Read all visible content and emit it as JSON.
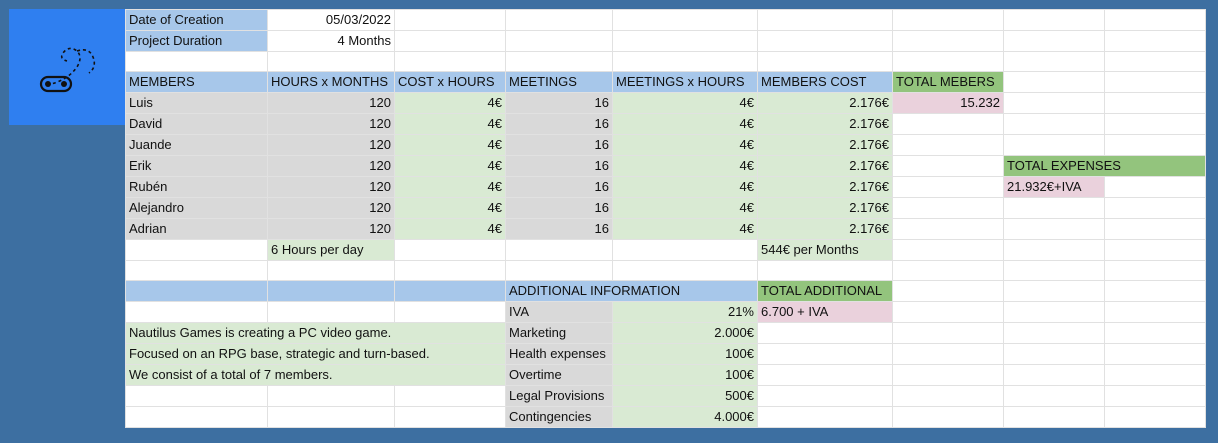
{
  "info": {
    "date_label": "Date of Creation",
    "date_value": "05/03/2022",
    "duration_label": "Project Duration",
    "duration_value": "4 Months"
  },
  "members_table": {
    "headers": [
      "MEMBERS",
      "HOURS x MONTHS",
      "COST x HOURS",
      "MEETINGS",
      "MEETINGS x HOURS",
      "MEMBERS COST",
      "TOTAL MEBERS"
    ],
    "rows": [
      [
        "Luis",
        "120",
        "4€",
        "16",
        "4€",
        "2.176€"
      ],
      [
        "David",
        "120",
        "4€",
        "16",
        "4€",
        "2.176€"
      ],
      [
        "Juande",
        "120",
        "4€",
        "16",
        "4€",
        "2.176€"
      ],
      [
        "Erik",
        "120",
        "4€",
        "16",
        "4€",
        "2.176€"
      ],
      [
        "Rubén",
        "120",
        "4€",
        "16",
        "4€",
        "2.176€"
      ],
      [
        "Alejandro",
        "120",
        "4€",
        "16",
        "4€",
        "2.176€"
      ],
      [
        "Adrian",
        "120",
        "4€",
        "16",
        "4€",
        "2.176€"
      ]
    ],
    "total_members_value": "15.232",
    "hours_note": "6 Hours per day",
    "months_note": "544€ per Months"
  },
  "expenses": {
    "label": "TOTAL EXPENSES",
    "value": "21.932€+IVA"
  },
  "additional": {
    "header": "ADDITIONAL INFORMATION",
    "total_label": "TOTAL ADDITIONAL",
    "total_value": "6.700 + IVA",
    "items": [
      [
        "IVA",
        "21%"
      ],
      [
        "Marketing",
        "2.000€"
      ],
      [
        "Health expenses",
        "100€"
      ],
      [
        "Overtime",
        "100€"
      ],
      [
        "Legal Provisions",
        "500€"
      ],
      [
        "Contingencies",
        "4.000€"
      ]
    ]
  },
  "description": [
    "Nautilus Games is creating a PC video game.",
    "Focused on an RPG base, strategic and turn-based.",
    "We consist of a total of 7 members."
  ],
  "logo": {
    "icon": "gamepad-nautilus-icon",
    "background": "#2f7ff0"
  }
}
